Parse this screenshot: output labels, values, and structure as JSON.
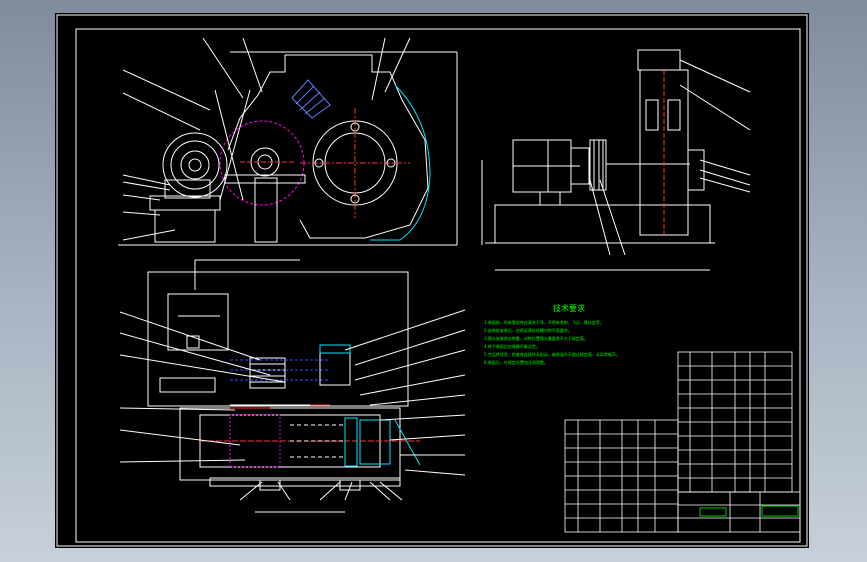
{
  "drawing": {
    "notes_title": "技术要求",
    "notes": [
      "1.装配前，所有零部件应清洗干净，不得有毛刺、飞边、氧化皮等。",
      "2.皮带轮安装后，应保证两轮轮槽对称平面重合。",
      "3.锤头安装前应称重，对称位置锤头重量差不大于规定值。",
      "4.转子装配后应做静平衡试验。",
      "5.空运转试验，检查各连接件无松动，轴承温升不超过规定值，无异常噪声。",
      "6.装配后，在规定位置加注润滑脂。"
    ]
  },
  "colors": {
    "background": "#000000",
    "frame": "#ffffff",
    "outline": "#ffffff",
    "annotation": "#00ff00",
    "center_line": "#ff3030",
    "hidden": "#ff00ff",
    "cyan": "#00e5ff",
    "blue": "#3050ff",
    "yellow": "#ffff00"
  }
}
